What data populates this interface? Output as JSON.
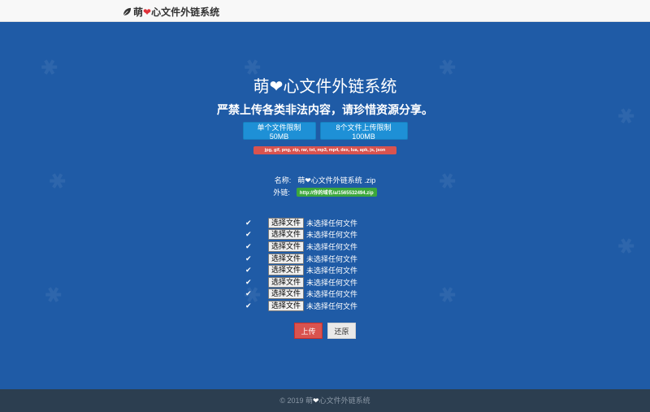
{
  "navbar": {
    "brand_prefix": "萌",
    "brand_heart": "❤",
    "brand_suffix": "心文件外链系统"
  },
  "hero": {
    "title_prefix": "萌",
    "title_heart": "❤",
    "title_suffix": "心文件外链系统",
    "subtitle": "严禁上传各类非法内容，请珍惜资源分享。",
    "single_limit": "单个文件限制50MB",
    "multi_limit": "8个文件上传限制100MB",
    "allowed_types": "jpg, gif, png, zip, rar, txt, mp3, mp4, dex, lua, apk, js, json"
  },
  "meta": {
    "name_label": "名称:",
    "name_value": "萌❤心文件外链系统 .zip",
    "link_label": "外链:",
    "link_value": "http://你的域名/a/1565532494.zip"
  },
  "uploads": {
    "check_glyph": "✔",
    "choose_label": "选择文件",
    "none_label": "未选择任何文件",
    "count": 8
  },
  "actions": {
    "upload": "上传",
    "reset": "还原"
  },
  "footer": {
    "prefix": "© 2019 萌",
    "heart": "❤",
    "suffix": "心文件外链系统"
  },
  "colors": {
    "hero": "#1f5ba6",
    "info_button": "#1e90d6",
    "danger": "#d9534f",
    "success": "#3ca83c",
    "footer": "#2c3e50"
  }
}
